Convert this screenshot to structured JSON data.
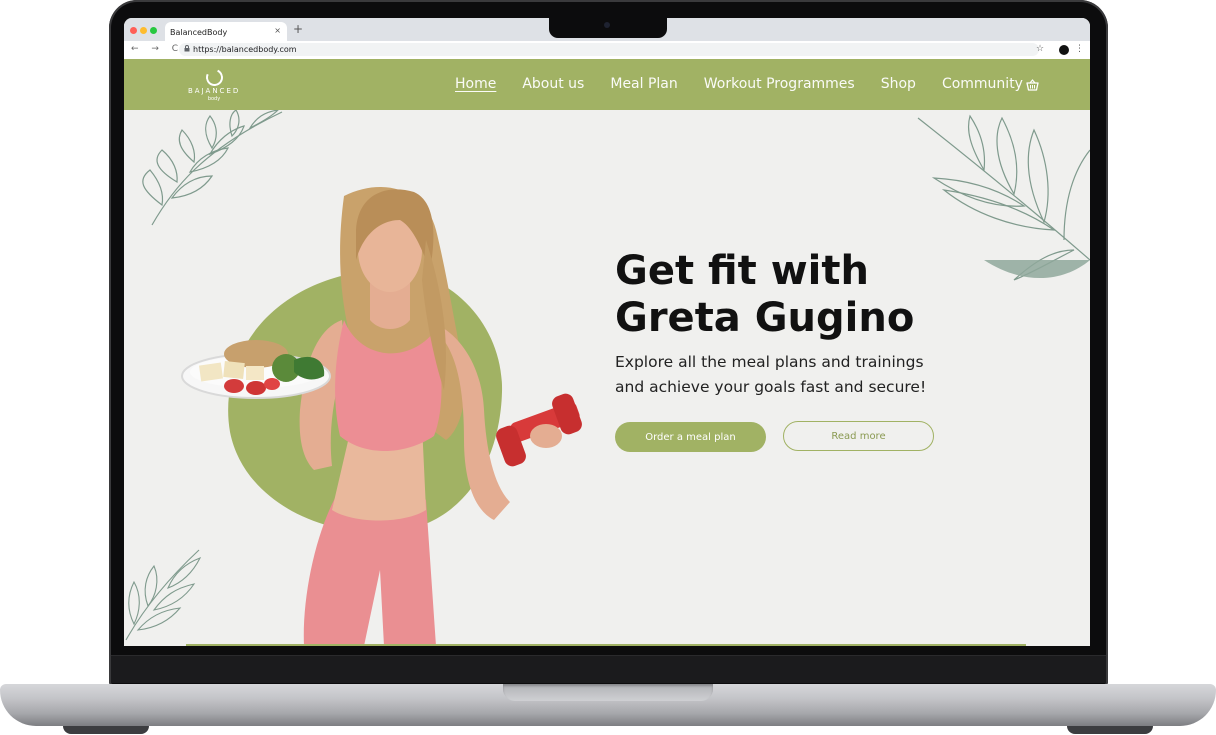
{
  "browser": {
    "tab_title": "BalancedBody",
    "tab_close": "×",
    "new_tab": "+",
    "nav_icons": "← → C",
    "url": "https://balancedbody.com",
    "lock": "🔒",
    "bookmark": "☆",
    "menu": "⋮",
    "traffic_colors": [
      "#ff5f57",
      "#febc2e",
      "#28c840"
    ]
  },
  "site": {
    "logo_main": "BAJANCED",
    "logo_sub": "body",
    "nav": [
      {
        "label": "Home",
        "active": true
      },
      {
        "label": "About us"
      },
      {
        "label": "Meal Plan"
      },
      {
        "label": "Workout Programmes"
      },
      {
        "label": "Shop"
      },
      {
        "label": "Community"
      }
    ],
    "cart_icon": "basket-icon"
  },
  "hero": {
    "title_line1": "Get fit with",
    "title_line2": "Greta Gugino",
    "subtitle_line1": "Explore all the meal plans and trainings",
    "subtitle_line2": "and achieve your goals fast and secure!",
    "primary_button": "Order a meal plan",
    "secondary_button": "Read more"
  },
  "colors": {
    "accent": "#a1b264",
    "background": "#f0f0ee",
    "leaf_stroke": "#7f9a8d",
    "outfit": "#e88a8a",
    "dumbbell": "#d83a3a"
  }
}
